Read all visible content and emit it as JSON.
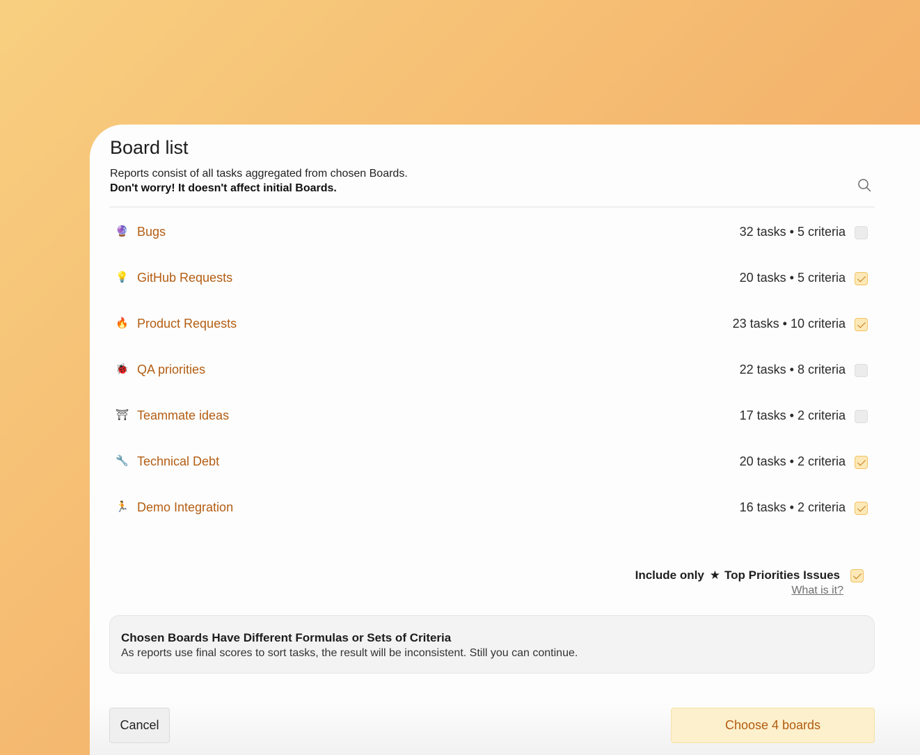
{
  "dialog": {
    "title": "Board list",
    "description": "Reports consist of all tasks aggregated from chosen Boards.",
    "note": "Don't worry! It doesn't affect initial Boards."
  },
  "boards": [
    {
      "icon": "🔮",
      "icon_name": "crystal-ball-icon",
      "name": "Bugs",
      "meta": "32 tasks • 5 criteria",
      "checked": false
    },
    {
      "icon": "💡",
      "icon_name": "light-bulb-icon",
      "name": "GitHub Requests",
      "meta": "20 tasks • 5 criteria",
      "checked": true
    },
    {
      "icon": "🔥",
      "icon_name": "fire-icon",
      "name": "Product Requests",
      "meta": "23 tasks • 10 criteria",
      "checked": true
    },
    {
      "icon": "🐞",
      "icon_name": "ladybug-icon",
      "name": "QA priorities",
      "meta": "22 tasks • 8 criteria",
      "checked": false
    },
    {
      "icon": "⛩",
      "icon_name": "shrine-gate-icon",
      "name": "Teammate ideas",
      "meta": "17 tasks • 2 criteria",
      "checked": false
    },
    {
      "icon": "🔧",
      "icon_name": "wrench-icon",
      "name": "Technical Debt",
      "meta": "20 tasks • 2 criteria",
      "checked": true
    },
    {
      "icon": "🏃",
      "icon_name": "runner-icon",
      "name": "Demo Integration",
      "meta": "16 tasks • 2 criteria",
      "checked": true
    }
  ],
  "filter": {
    "prefix": "Include only",
    "star_icon": "star-icon",
    "label": "Top Priorities Issues",
    "checked": true,
    "help_link": "What is it?"
  },
  "warning": {
    "title": "Chosen Boards Have Different Formulas or Sets of Criteria",
    "text": "As reports use final scores to sort tasks, the result will be inconsistent. Still you can continue."
  },
  "footer": {
    "cancel_label": "Cancel",
    "choose_label": "Choose 4 boards"
  }
}
